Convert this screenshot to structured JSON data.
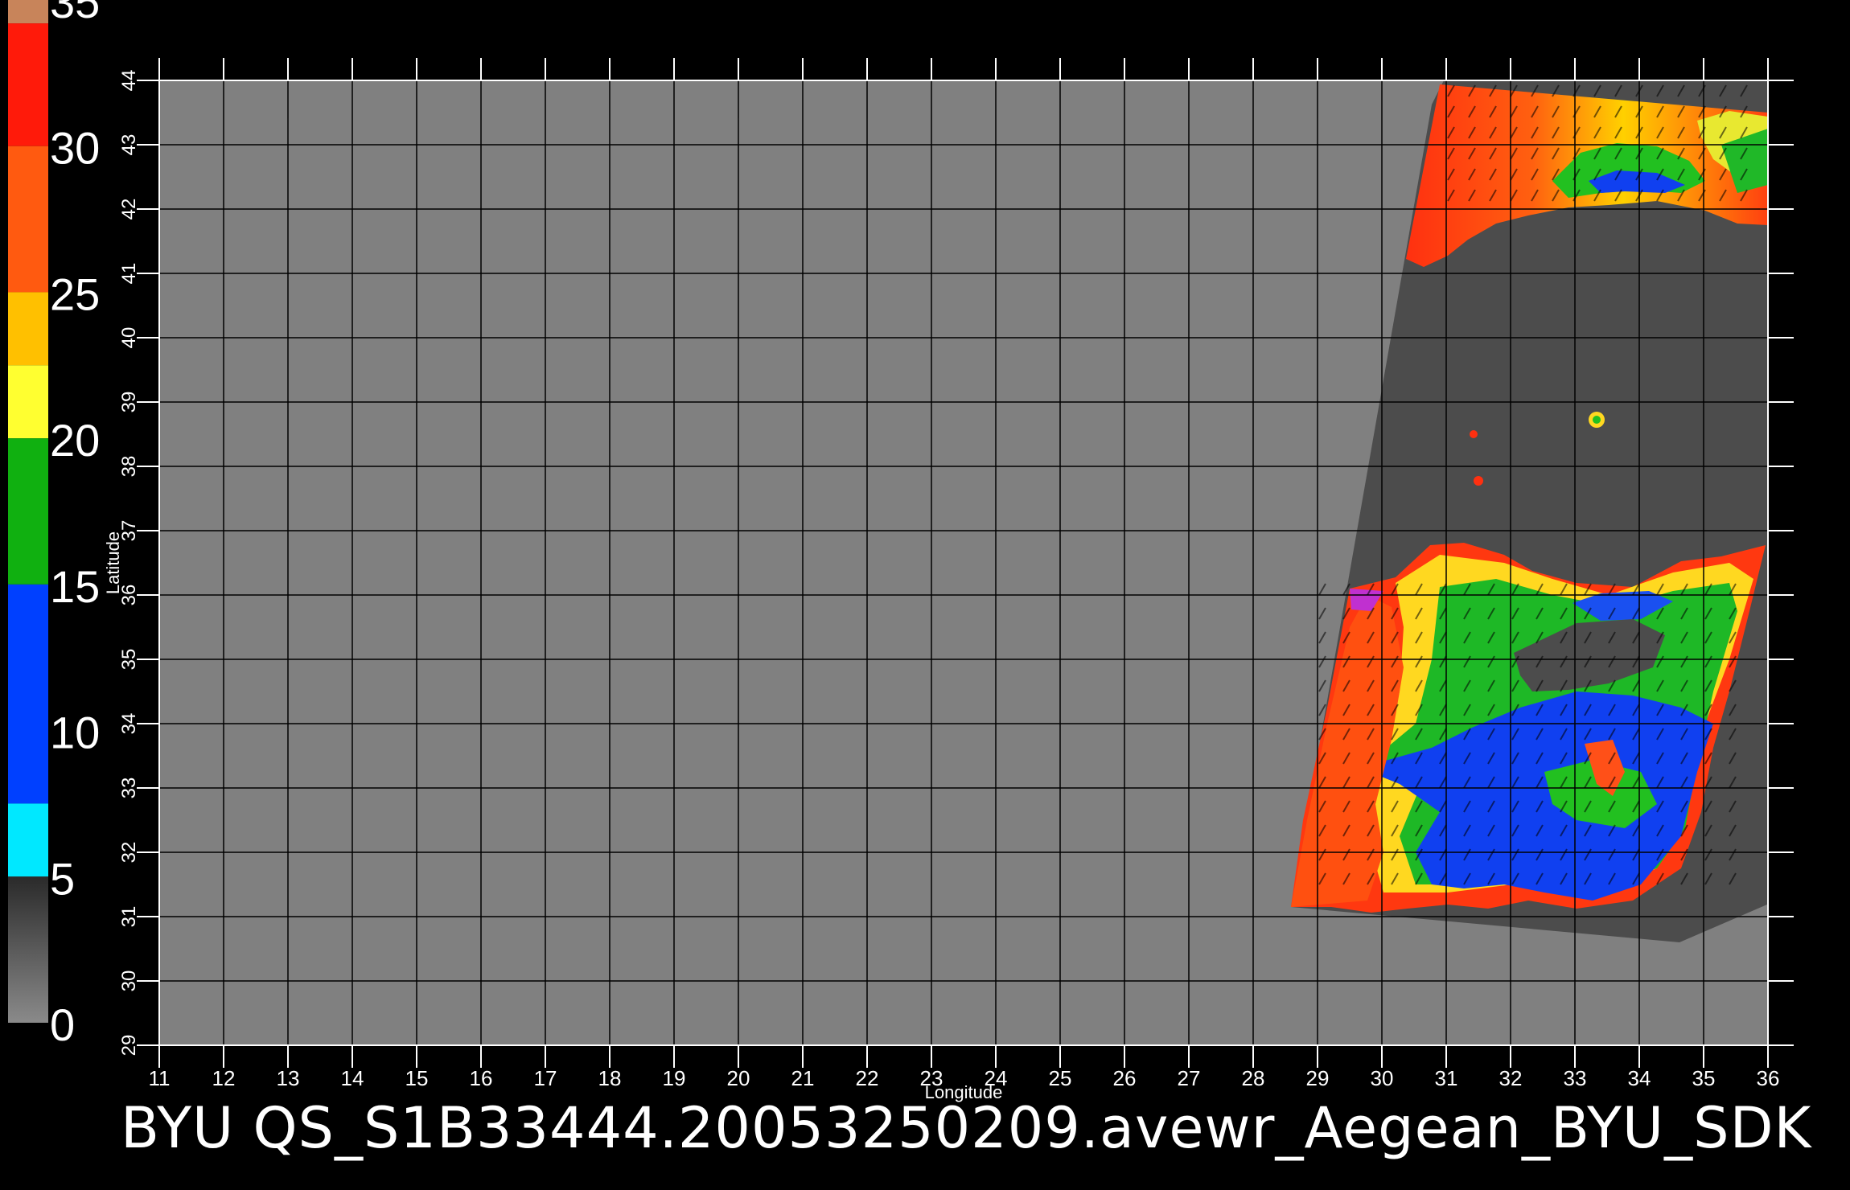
{
  "colorbar": {
    "labels": [
      "35",
      "30",
      "25",
      "20",
      "15",
      "10",
      "5",
      "0"
    ],
    "stops": [
      {
        "from": 35.0,
        "to": 34.2,
        "color": "#c8845a"
      },
      {
        "from": 34.2,
        "to": 30.0,
        "color": "#ff1a0a"
      },
      {
        "from": 30.0,
        "to": 25.0,
        "color": "#ff5a10"
      },
      {
        "from": 25.0,
        "to": 22.5,
        "color": "#ffc000"
      },
      {
        "from": 22.5,
        "to": 20.0,
        "color": "#ffff30"
      },
      {
        "from": 20.0,
        "to": 15.0,
        "color": "#10b010"
      },
      {
        "from": 15.0,
        "to": 7.5,
        "color": "#0040ff"
      },
      {
        "from": 7.5,
        "to": 5.0,
        "color": "#00e8ff"
      },
      {
        "from": 5.0,
        "to": 0.0,
        "color": "#444444"
      }
    ]
  },
  "map": {
    "lon_range": [
      11,
      36
    ],
    "lat_range": [
      29,
      44
    ],
    "lon_ticks": [
      "11",
      "12",
      "13",
      "14",
      "15",
      "16",
      "17",
      "18",
      "19",
      "20",
      "21",
      "22",
      "23",
      "24",
      "25",
      "26",
      "27",
      "28",
      "29",
      "30",
      "31",
      "32",
      "33",
      "34",
      "35",
      "36"
    ],
    "lat_ticks": [
      "29",
      "30",
      "31",
      "32",
      "33",
      "34",
      "35",
      "36",
      "37",
      "38",
      "39",
      "40",
      "41",
      "42",
      "43",
      "44"
    ],
    "xlabel": "Longitude",
    "ylabel": "Latitude",
    "background_color": "#808080",
    "swath_color": "#4c4c4c",
    "grid_color": "#000000"
  },
  "caption": "BYU  QS_S1B33444.20053250209.avewr_Aegean_BYU_SDK"
}
